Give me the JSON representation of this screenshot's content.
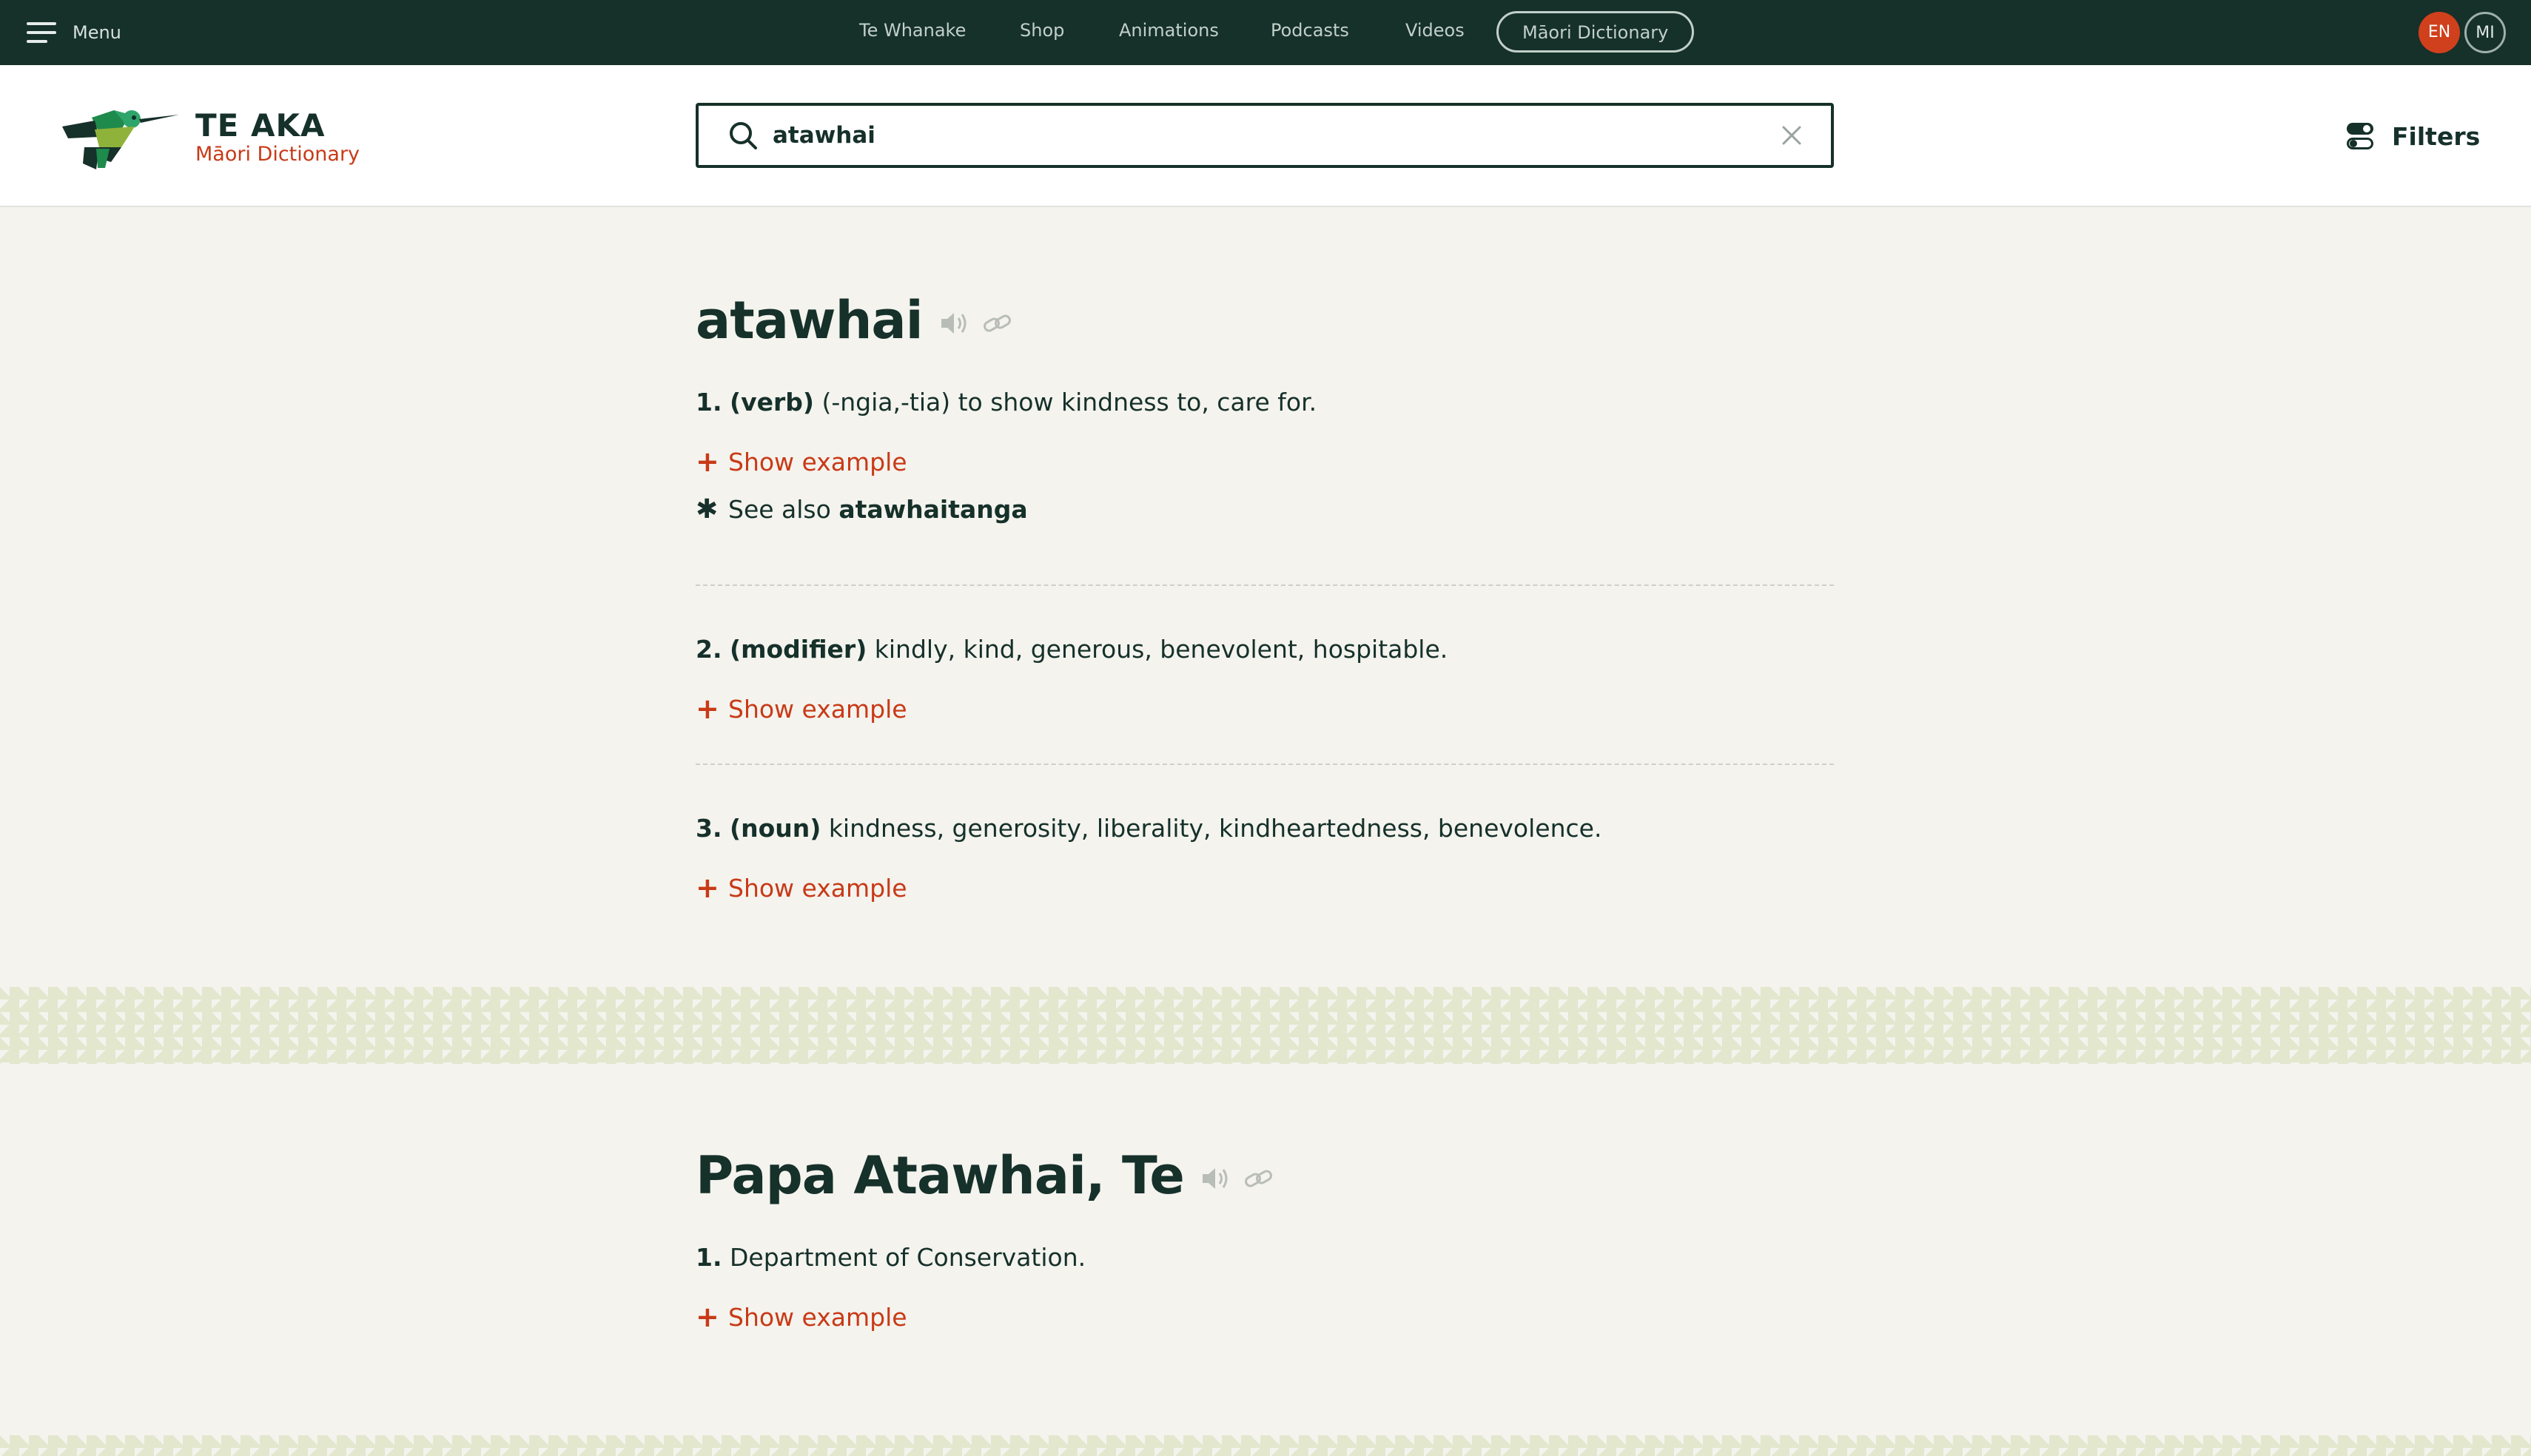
{
  "topnav": {
    "menu_label": "Menu",
    "links": [
      "Te Whanake",
      "Shop",
      "Animations",
      "Podcasts",
      "Videos",
      "Māori Dictionary"
    ],
    "languages": [
      "EN",
      "MI"
    ]
  },
  "header": {
    "logo_title": "TE AKA",
    "logo_subtitle": "Māori Dictionary",
    "search_value": "atawhai",
    "filters_label": "Filters"
  },
  "entries": [
    {
      "headword": "atawhai",
      "senses": [
        {
          "number": "1.",
          "pos": "(verb)",
          "text": " (-ngia,-tia) to show kindness to, care for."
        },
        {
          "number": "2.",
          "pos": "(modifier)",
          "text": " kindly, kind, generous, benevolent, hospitable."
        },
        {
          "number": "3.",
          "pos": "(noun)",
          "text": " kindness, generosity, liberality, kindheartedness, benevolence."
        }
      ],
      "see_also_label": "See also",
      "see_also_word": "atawhaitanga"
    },
    {
      "headword": "Papa Atawhai, Te",
      "senses": [
        {
          "number": "1.",
          "pos": "",
          "text": " Department of Conservation."
        }
      ]
    }
  ],
  "show_example_label": "Show example",
  "colors": {
    "nav_bg": "#16302a",
    "accent": "#c83a16",
    "lang_active": "#d1401c",
    "page_bg": "#f4f3ee"
  },
  "icons": [
    "hamburger-icon",
    "bird-logo",
    "search-icon",
    "clear-icon",
    "filters-icon",
    "speaker-icon",
    "link-icon",
    "plus-icon",
    "asterisk-icon"
  ]
}
